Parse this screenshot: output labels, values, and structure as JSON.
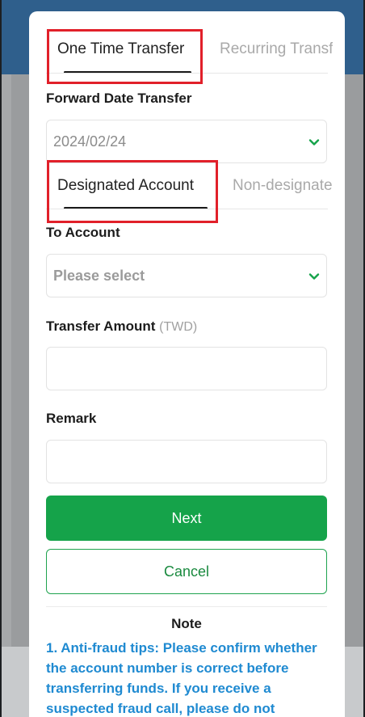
{
  "colors": {
    "primary_green": "#15a34a",
    "note_blue": "#1f8ad1",
    "highlight_red": "#e1202a"
  },
  "transfer_type_tabs": [
    {
      "label": "One Time Transfer",
      "active": true
    },
    {
      "label": "Recurring Transfer",
      "active": false
    }
  ],
  "forward_date": {
    "label": "Forward Date Transfer",
    "value": "2024/02/24",
    "icon": "chevron-down-icon"
  },
  "account_type_tabs": [
    {
      "label": "Designated Account",
      "active": true
    },
    {
      "label": "Non-designated Account",
      "active": false
    }
  ],
  "to_account": {
    "label": "To Account",
    "placeholder": "Please select",
    "icon": "chevron-down-icon"
  },
  "transfer_amount": {
    "label": "Transfer Amount",
    "unit": "(TWD)",
    "value": ""
  },
  "remark": {
    "label": "Remark",
    "value": ""
  },
  "buttons": {
    "next": "Next",
    "cancel": "Cancel"
  },
  "note": {
    "title": "Note",
    "text": "1. Anti-fraud tips: Please confirm whether the account number is correct before transferring funds. If you receive a suspected fraud call, please do not"
  }
}
